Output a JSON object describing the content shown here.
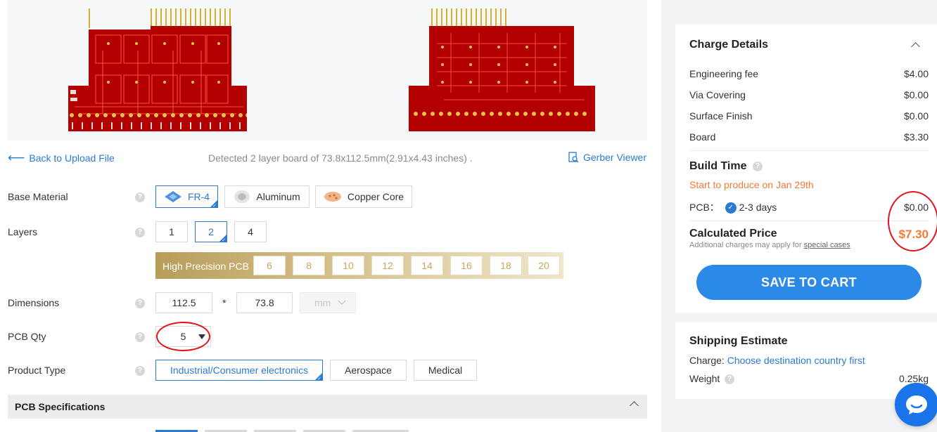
{
  "preview": {
    "detected_text": "Detected 2 layer board of 73.8x112.5mm(2.91x4.43 inches) .",
    "back_label": "Back to Upload File",
    "gerber_label": "Gerber Viewer"
  },
  "form": {
    "base_material": {
      "label": "Base Material",
      "options": [
        "FR-4",
        "Aluminum",
        "Copper Core"
      ],
      "selected": "FR-4"
    },
    "layers": {
      "label": "Layers",
      "options": [
        "1",
        "2",
        "4"
      ],
      "selected": "2",
      "high_precision_label": "High Precision PCB",
      "high_precision_options": [
        "6",
        "8",
        "10",
        "12",
        "14",
        "16",
        "18",
        "20"
      ]
    },
    "dimensions": {
      "label": "Dimensions",
      "width": "112.5",
      "separator": "*",
      "height": "73.8",
      "unit": "mm"
    },
    "qty": {
      "label": "PCB Qty",
      "value": "5"
    },
    "product_type": {
      "label": "Product Type",
      "options": [
        "Industrial/Consumer electronics",
        "Aerospace",
        "Medical"
      ],
      "selected": "Industrial/Consumer electronics"
    },
    "spec_section": "PCB Specifications"
  },
  "charge": {
    "title": "Charge Details",
    "fees": [
      {
        "name": "Engineering fee",
        "value": "$4.00"
      },
      {
        "name": "Via Covering",
        "value": "$0.00"
      },
      {
        "name": "Surface Finish",
        "value": "$0.00"
      },
      {
        "name": "Board",
        "value": "$3.30"
      }
    ],
    "build_time_title": "Build Time",
    "produce_note": "Start to produce on Jan 29th",
    "pcb_label": "PCB：",
    "pcb_days": "2-3 days",
    "pcb_price": "$0.00",
    "calc_title": "Calculated Price",
    "calc_value": "$7.30",
    "calc_note_prefix": "Additional charges may apply for ",
    "calc_note_link": "special cases",
    "save_button": "SAVE TO CART"
  },
  "shipping": {
    "title": "Shipping Estimate",
    "charge_label": "Charge:",
    "charge_link": "Choose destination country first",
    "weight_label": "Weight",
    "weight_value": "0.25kg"
  },
  "colors": {
    "accent_blue": "#2a7ad4",
    "price_orange": "#f27a35",
    "pcb_red": "#b30000",
    "annotation_red": "#e0151c"
  }
}
